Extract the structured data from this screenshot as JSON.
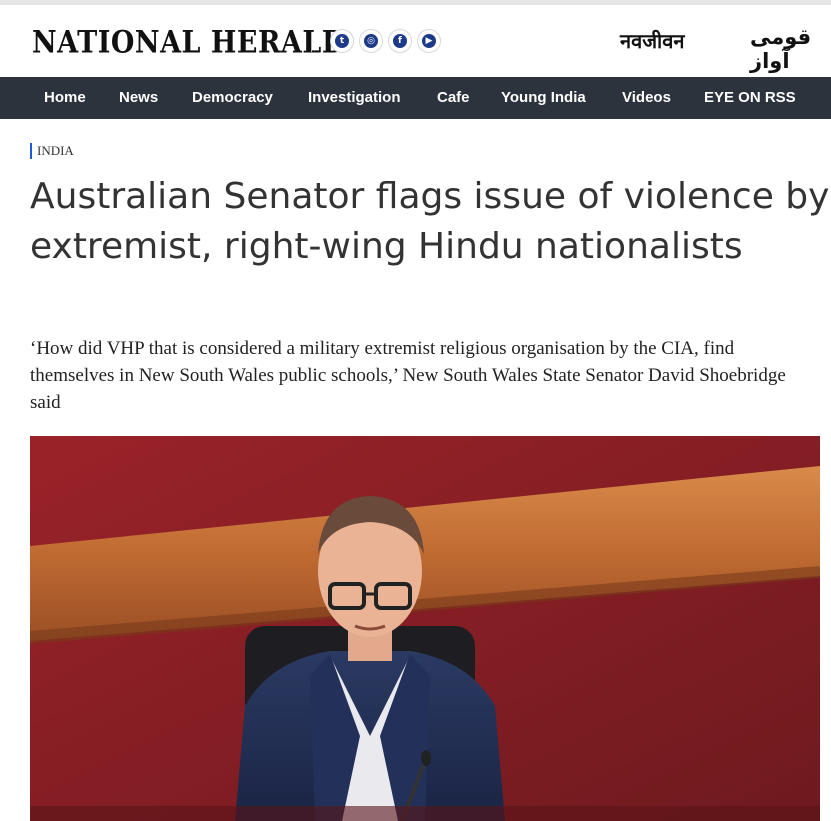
{
  "header": {
    "logo": "NATIONAL HERALD",
    "social": [
      {
        "icon": "twitter-icon",
        "glyph": "t"
      },
      {
        "icon": "instagram-icon",
        "glyph": "◎"
      },
      {
        "icon": "facebook-icon",
        "glyph": "f"
      },
      {
        "icon": "youtube-icon",
        "glyph": "▶"
      }
    ],
    "sister_hindi": "नवजीवन",
    "sister_urdu": "قومی آواز"
  },
  "nav": {
    "items": [
      {
        "label": "Home"
      },
      {
        "label": "News"
      },
      {
        "label": "Democracy"
      },
      {
        "label": "Investigation"
      },
      {
        "label": "Cafe"
      },
      {
        "label": "Young India"
      },
      {
        "label": "Videos"
      },
      {
        "label": "EYE ON RSS"
      }
    ]
  },
  "article": {
    "section": "INDIA",
    "headline": "Australian Senator flags issue of violence by extremist, right-wing Hindu nationalists",
    "summary": "‘How did VHP that is considered a military extremist religious organisation by the CIA, find themselves in New South Wales public schools,’ New South Wales State Senator David Shoebridge said"
  },
  "colors": {
    "nav_bg": "#2c333d",
    "section_accent": "#1e5bd6",
    "social_icon": "#1d3a8a"
  }
}
